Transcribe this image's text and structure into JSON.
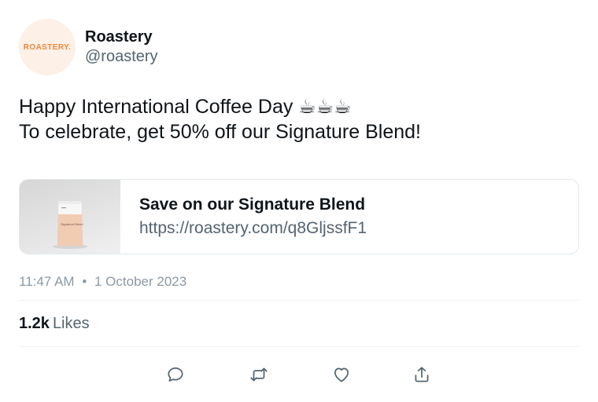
{
  "account": {
    "avatar_text": "ROASTERY.",
    "display_name": "Roastery",
    "handle": "@roastery"
  },
  "tweet": {
    "line1": "Happy International Coffee Day ☕☕☕",
    "line2": "To celebrate, get 50% off our Signature Blend!"
  },
  "card": {
    "title": "Save on our Signature Blend",
    "url": "https://roastery.com/q8GljssfF1",
    "product_label": "Signature Blend"
  },
  "meta": {
    "time": "11:47 AM",
    "separator": "•",
    "date": "1 October 2023"
  },
  "stats": {
    "likes_count": "1.2k",
    "likes_label": "Likes"
  },
  "actions": [
    {
      "icon": "reply-icon"
    },
    {
      "icon": "retweet-icon"
    },
    {
      "icon": "like-icon"
    },
    {
      "icon": "share-icon"
    }
  ],
  "colors": {
    "brand_orange": "#ea8a3b",
    "avatar_bg": "#fdf0e6",
    "secondary_text": "#536471",
    "icon_gray": "#536471"
  }
}
